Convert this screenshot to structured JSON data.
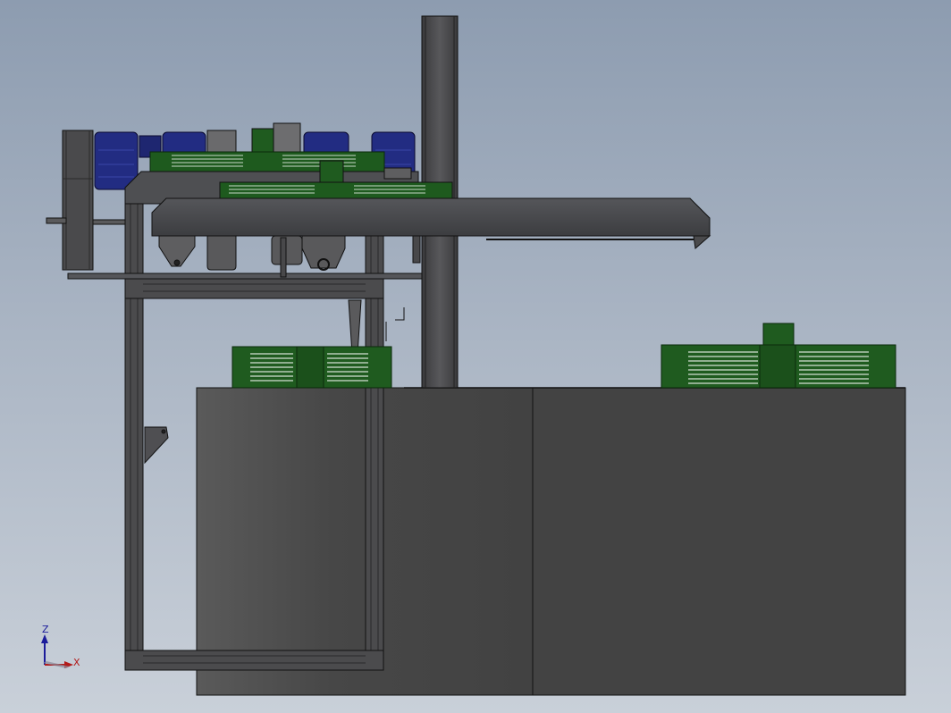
{
  "viewport": {
    "background_top": "#8d9cb0",
    "background_bottom": "#c9d0d9"
  },
  "colors": {
    "frame": "#4d4d4f",
    "frame_dark": "#2e2e30",
    "motor_green": "#1f5b1f",
    "motor_blue": "#202a80",
    "cabinet": "#464646",
    "outline": "#111111"
  },
  "triad": {
    "z_label": "Z",
    "x_label": "X",
    "z_color": "#1b1b9a",
    "x_color": "#b21b1b"
  }
}
